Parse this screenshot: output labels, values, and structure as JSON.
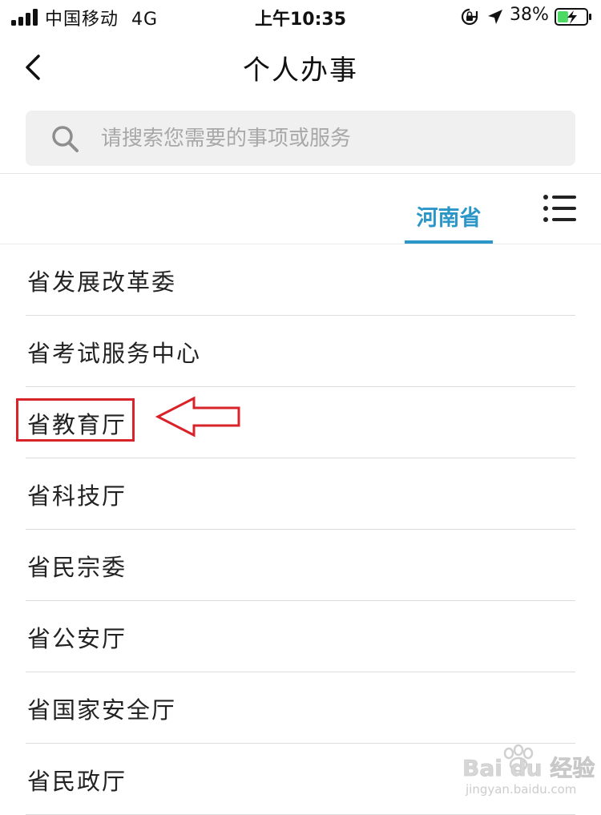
{
  "status_bar": {
    "carrier": "中国移动",
    "network": "4G",
    "time": "上午10:35",
    "battery_percent": "38%",
    "battery_level": 0.38
  },
  "header": {
    "title": "个人办事"
  },
  "search": {
    "placeholder": "请搜索您需要的事项或服务"
  },
  "tabs": [
    {
      "label": "河南省",
      "active": true
    }
  ],
  "list": {
    "items": [
      "省发展改革委",
      "省考试服务中心",
      "省教育厅",
      "省科技厅",
      "省民宗委",
      "省公安厅",
      "省国家安全厅",
      "省民政厅"
    ],
    "highlighted_index": 2
  },
  "watermark": {
    "brand": "Bai du 经验",
    "url": "jingyan.baidu.com"
  },
  "colors": {
    "accent": "#2b97c9",
    "annotation": "#d9232a"
  }
}
